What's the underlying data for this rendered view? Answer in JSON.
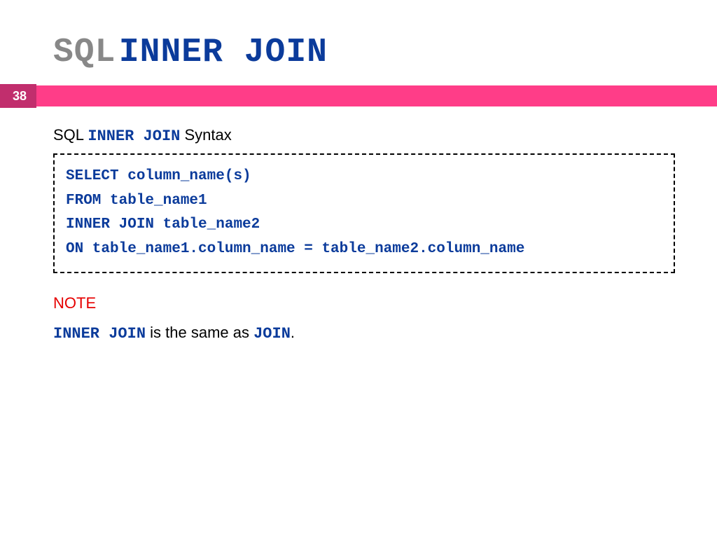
{
  "title": {
    "prefix": "SQL",
    "highlight": "INNER JOIN"
  },
  "page_number": "38",
  "subtitle": {
    "prefix": "SQL",
    "highlight": "INNER JOIN",
    "suffix": "Syntax"
  },
  "code": {
    "line1": "SELECT column_name(s)",
    "line2": "FROM table_name1",
    "line3": "INNER JOIN table_name2",
    "line4": "ON table_name1.column_name = table_name2.column_name"
  },
  "note": {
    "label": "NOTE",
    "kw1": "INNER JOIN",
    "mid": " is the same as ",
    "kw2": "JOIN",
    "end": "."
  }
}
